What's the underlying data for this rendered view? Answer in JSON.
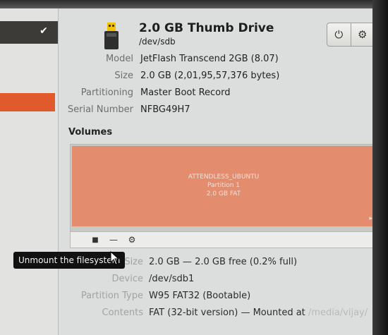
{
  "drive": {
    "title": "2.0 GB Thumb Drive",
    "device": "/dev/sdb",
    "info": [
      {
        "label": "Model",
        "value": "JetFlash Transcend 2GB (8.07)"
      },
      {
        "label": "Size",
        "value": "2.0 GB (2,01,95,57,376 bytes)"
      },
      {
        "label": "Partitioning",
        "value": "Master Boot Record"
      },
      {
        "label": "Serial Number",
        "value": "NFBG49H7"
      }
    ]
  },
  "header_buttons": {
    "power": "⏻",
    "settings": "⚙"
  },
  "left_pane": {
    "check": "✔"
  },
  "volumes": {
    "heading": "Volumes",
    "partition": {
      "name": "ATTENDLESS_UBUNTU",
      "number": "Partition 1",
      "size": "2.0 GB FAT"
    },
    "toolbar": {
      "unmount": "■",
      "remove": "—",
      "settings": "⚙"
    }
  },
  "tooltip": "Unmount the filesystem",
  "details": [
    {
      "label": "Size",
      "value": "2.0 GB — 2.0 GB free (0.2% full)"
    },
    {
      "label": "Device",
      "value": "/dev/sdb1"
    },
    {
      "label": "Partition Type",
      "value": "W95 FAT32 (Bootable)"
    },
    {
      "label": "Contents",
      "value": "FAT (32-bit version) — Mounted at",
      "link": "/media/vijay/"
    }
  ]
}
